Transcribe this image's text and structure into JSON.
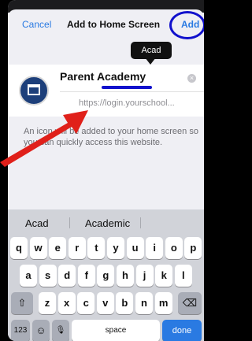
{
  "nav": {
    "cancel_label": "Cancel",
    "title": "Add to Home Screen",
    "add_label": "Add"
  },
  "tooltip": {
    "text": "Acad"
  },
  "site": {
    "name_value": "Parent Academy",
    "url": "https://login.yourschool..."
  },
  "description": "An icon will be added to your home screen so you can quickly access this website.",
  "keyboard": {
    "suggestions": [
      "Acad",
      "Academic"
    ],
    "row1": [
      "q",
      "w",
      "e",
      "r",
      "t",
      "y",
      "u",
      "i",
      "o",
      "p"
    ],
    "row2": [
      "a",
      "s",
      "d",
      "f",
      "g",
      "h",
      "j",
      "k",
      "l"
    ],
    "row3": [
      "z",
      "x",
      "c",
      "v",
      "b",
      "n",
      "m"
    ],
    "shift_icon": "⇧",
    "delete_icon": "⌫",
    "numbers_label": "123",
    "emoji_icon": "☺",
    "mic_icon": "🎙",
    "space_label": "space",
    "done_label": "done"
  },
  "colors": {
    "accent": "#2a7ae2",
    "annotation_blue": "#1111cc",
    "annotation_red": "#e0201a"
  }
}
